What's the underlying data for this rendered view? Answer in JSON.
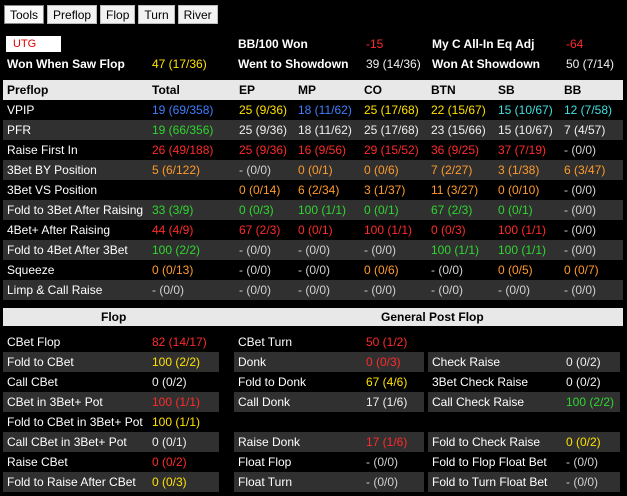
{
  "tabs": [
    "Tools",
    "Preflop",
    "Flop",
    "Turn",
    "River"
  ],
  "header": {
    "position": "UTG",
    "bb100_label": "BB/100  Won",
    "bb100_value": "-15",
    "allin_label": "My C All-In Eq Adj",
    "allin_value": "-64",
    "wwsf_label": "Won When Saw Flop",
    "wwsf_value": "47 (17/36)",
    "wtsd_label": "Went to Showdown",
    "wtsd_value": "39 (14/36)",
    "wsd_label": "Won At Showdown",
    "wsd_value": "50 (7/14)"
  },
  "preflop": {
    "columns": [
      "Preflop",
      "Total",
      "EP",
      "MP",
      "CO",
      "BTN",
      "SB",
      "BB"
    ],
    "rows": [
      {
        "label": "VPIP",
        "cells": [
          [
            "19 (69/358)",
            "blue"
          ],
          [
            "25 (9/36)",
            "yellow"
          ],
          [
            "18 (11/62)",
            "blue"
          ],
          [
            "25 (17/68)",
            "yellow"
          ],
          [
            "22 (15/67)",
            "yellow"
          ],
          [
            "15 (10/67)",
            "cyan"
          ],
          [
            "12 (7/58)",
            "cyan"
          ]
        ]
      },
      {
        "label": "PFR",
        "cells": [
          [
            "19 (66/356)",
            "green"
          ],
          [
            "25 (9/36)",
            "white"
          ],
          [
            "18 (11/62)",
            "white"
          ],
          [
            "25 (17/68)",
            "white"
          ],
          [
            "23 (15/66)",
            "white"
          ],
          [
            "15 (10/67)",
            "white"
          ],
          [
            "7 (4/57)",
            "white"
          ]
        ]
      },
      {
        "label": "Raise First In",
        "cells": [
          [
            "26 (49/188)",
            "red"
          ],
          [
            "25 (9/36)",
            "red"
          ],
          [
            "16 (9/56)",
            "red"
          ],
          [
            "29 (15/52)",
            "red"
          ],
          [
            "36 (9/25)",
            "red"
          ],
          [
            "37 (7/19)",
            "red"
          ],
          [
            "- (0/0)",
            "gray"
          ]
        ]
      },
      {
        "label": "3Bet BY Position",
        "cells": [
          [
            "5 (6/122)",
            "orange"
          ],
          [
            "- (0/0)",
            "gray"
          ],
          [
            "0 (0/1)",
            "orange"
          ],
          [
            "0 (0/6)",
            "orange"
          ],
          [
            "7 (2/27)",
            "orange"
          ],
          [
            "3 (1/38)",
            "orange"
          ],
          [
            "6 (3/47)",
            "orange"
          ]
        ]
      },
      {
        "label": "3Bet VS Position",
        "cells": [
          [
            "0 (0/14)",
            "orange"
          ],
          [
            "6 (2/34)",
            "orange"
          ],
          [
            "3 (1/37)",
            "orange"
          ],
          [
            "11 (3/27)",
            "orange"
          ],
          [
            "0 (0/10)",
            "orange"
          ],
          [
            "- (0/0)",
            "gray"
          ]
        ],
        "offset": 1
      },
      {
        "label": "Fold to 3Bet After Raising",
        "cells": [
          [
            "33 (3/9)",
            "green"
          ],
          [
            "0 (0/3)",
            "green"
          ],
          [
            "100 (1/1)",
            "green"
          ],
          [
            "0 (0/1)",
            "green"
          ],
          [
            "67 (2/3)",
            "green"
          ],
          [
            "0 (0/1)",
            "green"
          ],
          [
            "- (0/0)",
            "gray"
          ]
        ]
      },
      {
        "label": "4Bet+ After Raising",
        "cells": [
          [
            "44 (4/9)",
            "red"
          ],
          [
            "67 (2/3)",
            "red"
          ],
          [
            "0 (0/1)",
            "red"
          ],
          [
            "100 (1/1)",
            "red"
          ],
          [
            "0 (0/3)",
            "red"
          ],
          [
            "100 (1/1)",
            "red"
          ],
          [
            "- (0/0)",
            "gray"
          ]
        ]
      },
      {
        "label": "Fold to 4Bet After 3Bet",
        "cells": [
          [
            "100 (2/2)",
            "green"
          ],
          [
            "- (0/0)",
            "gray"
          ],
          [
            "- (0/0)",
            "gray"
          ],
          [
            "- (0/0)",
            "gray"
          ],
          [
            "100 (1/1)",
            "green"
          ],
          [
            "100 (1/1)",
            "green"
          ],
          [
            "- (0/0)",
            "gray"
          ]
        ]
      },
      {
        "label": "Squeeze",
        "cells": [
          [
            "0 (0/13)",
            "orange"
          ],
          [
            "- (0/0)",
            "gray"
          ],
          [
            "- (0/0)",
            "gray"
          ],
          [
            "0 (0/6)",
            "orange"
          ],
          [
            "- (0/0)",
            "gray"
          ],
          [
            "0 (0/5)",
            "orange"
          ],
          [
            "0 (0/7)",
            "orange"
          ]
        ]
      },
      {
        "label": "Limp & Call Raise",
        "cells": [
          [
            "- (0/0)",
            "gray"
          ],
          [
            "- (0/0)",
            "gray"
          ],
          [
            "- (0/0)",
            "gray"
          ],
          [
            "- (0/0)",
            "gray"
          ],
          [
            "- (0/0)",
            "gray"
          ],
          [
            "- (0/0)",
            "gray"
          ],
          [
            "- (0/0)",
            "gray"
          ]
        ]
      }
    ]
  },
  "flop_title": "Flop",
  "general_title": "General Post Flop",
  "flop_rows": [
    {
      "label": "CBet Flop",
      "value": "82 (14/17)",
      "color": "red"
    },
    {
      "label": "Fold to CBet",
      "value": "100 (2/2)",
      "color": "yellow"
    },
    {
      "label": "Call CBet",
      "value": "0 (0/2)",
      "color": "white"
    },
    {
      "label": "CBet in 3Bet+ Pot",
      "value": "100 (1/1)",
      "color": "red"
    },
    {
      "label": "Fold to CBet in 3Bet+ Pot",
      "value": "100 (1/1)",
      "color": "yellow"
    },
    {
      "label": "Call CBet in 3Bet+ Pot",
      "value": "0 (0/1)",
      "color": "white"
    },
    {
      "label": "Raise CBet",
      "value": "0 (0/2)",
      "color": "red"
    },
    {
      "label": "Fold to Raise After CBet",
      "value": "0 (0/3)",
      "color": "yellow"
    }
  ],
  "mid_rows": [
    {
      "label": "CBet Turn",
      "value": "50 (1/2)",
      "color": "red"
    },
    {
      "label": "Donk",
      "value": "0 (0/3)",
      "color": "red"
    },
    {
      "label": "Fold to Donk",
      "value": "67 (4/6)",
      "color": "yellow"
    },
    {
      "label": "Call Donk",
      "value": "17 (1/6)",
      "color": "white"
    },
    {
      "label": "",
      "value": "",
      "color": "white"
    },
    {
      "label": "Raise Donk",
      "value": "17 (1/6)",
      "color": "red"
    },
    {
      "label": "Float Flop",
      "value": "- (0/0)",
      "color": "gray"
    },
    {
      "label": "Float Turn",
      "value": "- (0/0)",
      "color": "gray"
    }
  ],
  "right_rows": [
    {
      "label": "",
      "value": "",
      "color": "white"
    },
    {
      "label": "Check Raise",
      "value": "0 (0/2)",
      "color": "white"
    },
    {
      "label": "3Bet Check Raise",
      "value": "0 (0/2)",
      "color": "white"
    },
    {
      "label": "Call Check Raise",
      "value": "100 (2/2)",
      "color": "green"
    },
    {
      "label": "",
      "value": "",
      "color": "white"
    },
    {
      "label": "Fold to Check Raise",
      "value": "0 (0/2)",
      "color": "yellow"
    },
    {
      "label": "Fold to Flop Float Bet",
      "value": "- (0/0)",
      "color": "gray"
    },
    {
      "label": "Fold to Turn Float Bet",
      "value": "- (0/0)",
      "color": "gray"
    }
  ]
}
